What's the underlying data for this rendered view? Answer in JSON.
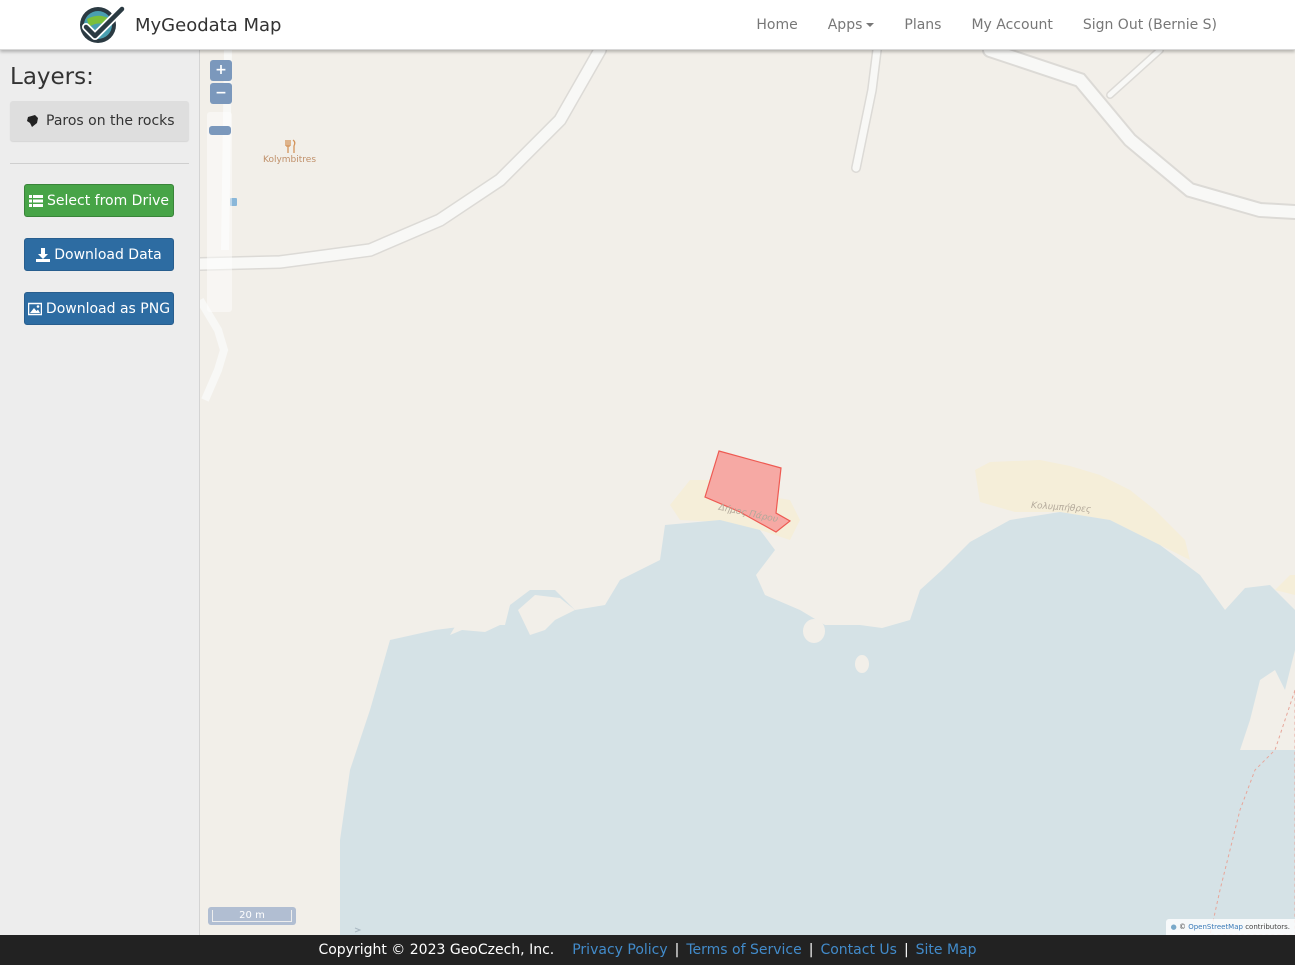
{
  "navbar": {
    "brand": "MyGeodata Map",
    "items": [
      {
        "label": "Home"
      },
      {
        "label": "Apps"
      },
      {
        "label": "Plans"
      },
      {
        "label": "My Account"
      },
      {
        "label": "Sign Out (Bernie S)"
      }
    ]
  },
  "sidebar": {
    "title": "Layers:",
    "layer_name": "Paros on the rocks",
    "buttons": {
      "select_drive": "Select from Drive",
      "download_data": "Download Data",
      "download_png": "Download as PNG"
    }
  },
  "map": {
    "zoom_in": "+",
    "zoom_out": "−",
    "poi_label": "Kolymbitres",
    "place_labels": {
      "municipality": "Δήμος Πάρου",
      "beach": "Κολυμπήθρες"
    },
    "scale": "20 m",
    "attribution": {
      "prefix": "©",
      "link": "OpenStreetMap",
      "suffix": "contributors."
    },
    "colors": {
      "land": "#f2efe9",
      "water": "#d5e2e6",
      "sand": "#f5eed9",
      "road": "#f8f8f6",
      "polygon_fill": "#f6a9a4",
      "polygon_stroke": "#ee5a52"
    }
  },
  "footer": {
    "copyright": "Copyright © 2023 GeoCzech, Inc.",
    "links": [
      "Privacy Policy",
      "Terms of Service",
      "Contact Us",
      "Site Map"
    ],
    "separator": "|"
  }
}
